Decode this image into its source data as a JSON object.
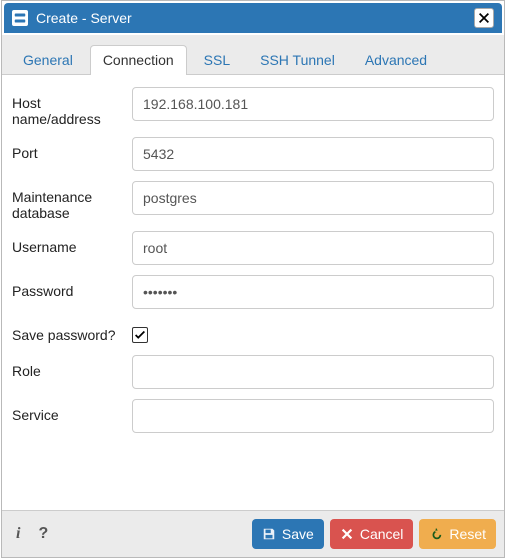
{
  "title": "Create - Server",
  "tabs": [
    {
      "label": "General",
      "active": false
    },
    {
      "label": "Connection",
      "active": true
    },
    {
      "label": "SSL",
      "active": false
    },
    {
      "label": "SSH Tunnel",
      "active": false
    },
    {
      "label": "Advanced",
      "active": false
    }
  ],
  "form": {
    "host_label": "Host name/address",
    "host_value": "192.168.100.181",
    "port_label": "Port",
    "port_value": "5432",
    "maintdb_label": "Maintenance database",
    "maintdb_value": "postgres",
    "username_label": "Username",
    "username_value": "root",
    "password_label": "Password",
    "password_value": "•••••••",
    "savepw_label": "Save password?",
    "savepw_checked": true,
    "role_label": "Role",
    "role_value": "",
    "service_label": "Service",
    "service_value": ""
  },
  "footer": {
    "save": "Save",
    "cancel": "Cancel",
    "reset": "Reset"
  }
}
